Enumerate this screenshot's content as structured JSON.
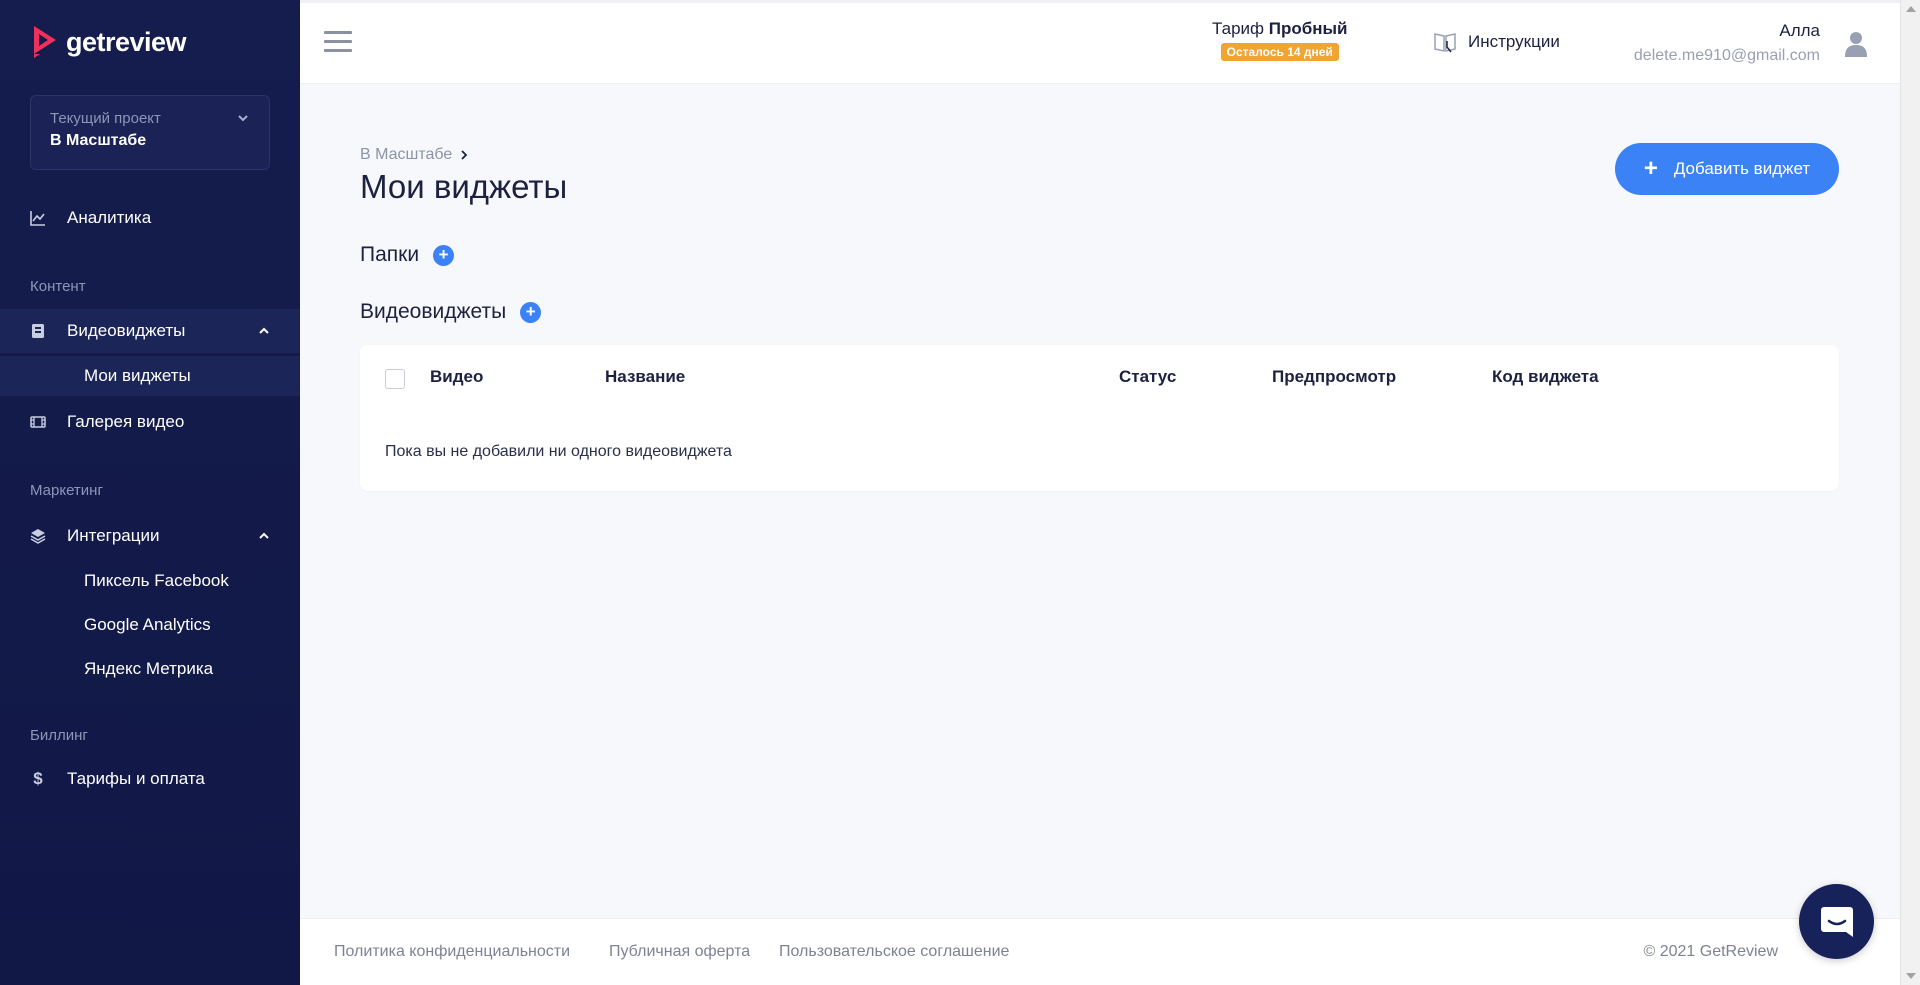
{
  "brand": {
    "name": "getreview",
    "accent": "#3b82f6",
    "sidebar_bg": "#131b4c",
    "logo_red": "#f0305a"
  },
  "project": {
    "caption": "Текущий проект",
    "name": "В Масштабе"
  },
  "sidebar": {
    "analytics": "Аналитика",
    "section_content": "Контент",
    "videowidgets": "Видеовиджеты",
    "my_widgets": "Мои виджеты",
    "gallery": "Галерея видео",
    "section_marketing": "Маркетинг",
    "integrations": "Интеграции",
    "facebook_pixel": "Пиксель Facebook",
    "google_analytics": "Google Analytics",
    "yandex_metrika": "Яндекс Метрика",
    "section_billing": "Биллинг",
    "billing": "Тарифы и оплата"
  },
  "header": {
    "tariff_prefix": "Тариф",
    "tariff_name": "Пробный",
    "trial_left": "Осталось 14 дней",
    "instructions": "Инструкции",
    "user_name": "Алла",
    "user_email": "delete.me910@gmail.com"
  },
  "main": {
    "breadcrumb": "В Масштабе",
    "title": "Мои виджеты",
    "add_widget": "Добавить виджет",
    "folders": "Папки",
    "videowidgets": "Видеовиджеты",
    "columns": {
      "video": "Видео",
      "name": "Название",
      "status": "Статус",
      "preview": "Предпросмотр",
      "code": "Код виджета"
    },
    "empty": "Пока вы не добавили ни одного видеовиджета"
  },
  "footer": {
    "privacy": "Политика конфиденциальности",
    "offer": "Публичная оферта",
    "agreement": "Пользовательское соглашение",
    "copyright": "© 2021 GetReview"
  }
}
